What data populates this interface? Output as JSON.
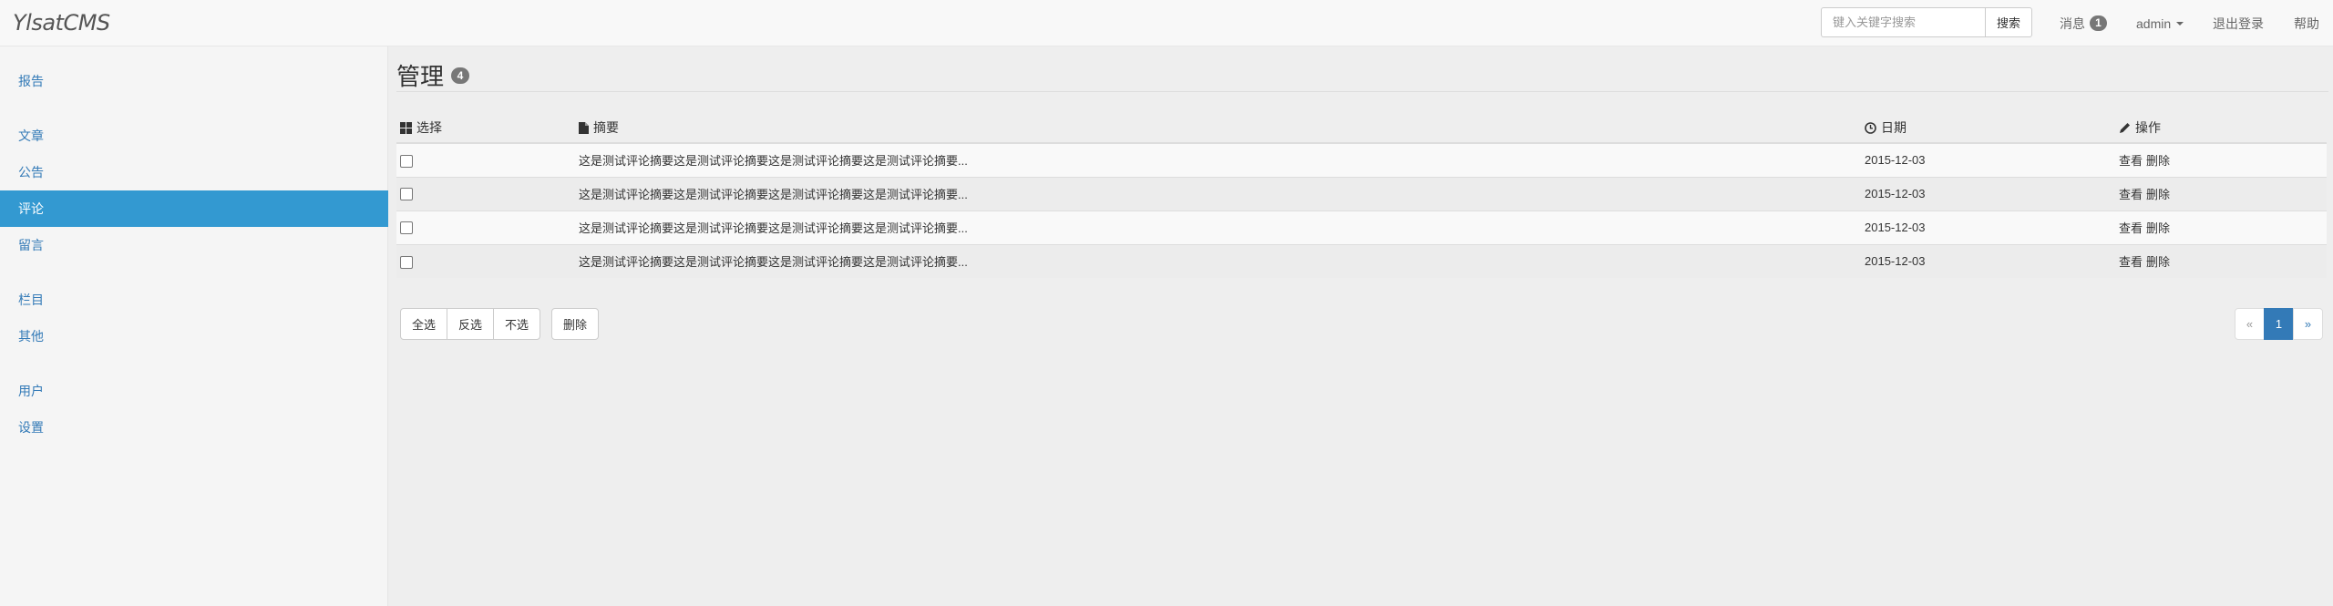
{
  "brand": "YlsatCMS",
  "search": {
    "placeholder": "键入关键字搜索",
    "button": "搜索"
  },
  "nav": {
    "messages_label": "消息",
    "messages_count": "1",
    "admin_label": "admin",
    "logout_label": "退出登录",
    "help_label": "帮助"
  },
  "sidebar": {
    "items": [
      {
        "label": "报告"
      },
      {
        "label": "文章"
      },
      {
        "label": "公告"
      },
      {
        "label": "评论",
        "active": true
      },
      {
        "label": "留言"
      },
      {
        "label": "栏目"
      },
      {
        "label": "其他"
      },
      {
        "label": "用户"
      },
      {
        "label": "设置"
      }
    ]
  },
  "main": {
    "title": "管理",
    "title_count": "4",
    "table": {
      "headers": {
        "select": "选择",
        "summary": "摘要",
        "date": "日期",
        "actions": "操作"
      },
      "rows": [
        {
          "summary": "这是测试评论摘要这是测试评论摘要这是测试评论摘要这是测试评论摘要...",
          "date": "2015-12-03",
          "view": "查看",
          "delete": "删除"
        },
        {
          "summary": "这是测试评论摘要这是测试评论摘要这是测试评论摘要这是测试评论摘要...",
          "date": "2015-12-03",
          "view": "查看",
          "delete": "删除"
        },
        {
          "summary": "这是测试评论摘要这是测试评论摘要这是测试评论摘要这是测试评论摘要...",
          "date": "2015-12-03",
          "view": "查看",
          "delete": "删除"
        },
        {
          "summary": "这是测试评论摘要这是测试评论摘要这是测试评论摘要这是测试评论摘要...",
          "date": "2015-12-03",
          "view": "查看",
          "delete": "删除"
        }
      ]
    },
    "bulk": {
      "select_all": "全选",
      "invert": "反选",
      "select_none": "不选",
      "delete": "删除"
    },
    "pagination": {
      "prev": "«",
      "current": "1",
      "next": "»"
    }
  },
  "colors": {
    "accent": "#3399d1",
    "link": "#337ab7",
    "badge": "#777777"
  }
}
